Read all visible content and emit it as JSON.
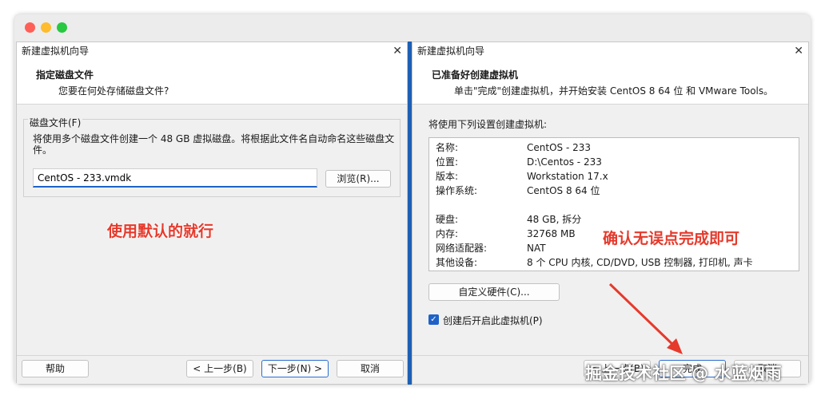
{
  "left_dialog": {
    "title": "新建虚拟机向导",
    "close": "✕",
    "heading": "指定磁盘文件",
    "subheading": "您要在何处存储磁盘文件?",
    "group_label": "磁盘文件(F)",
    "description": "将使用多个磁盘文件创建一个 48 GB 虚拟磁盘。将根据此文件名自动命名这些磁盘文件。",
    "file_value": "CentOS - 233.vmdk",
    "browse_label": "浏览(R)...",
    "help_label": "帮助",
    "prev_label": "< 上一步(B)",
    "next_label": "下一步(N) >",
    "cancel_label": "取消"
  },
  "right_dialog": {
    "title": "新建虚拟机向导",
    "close": "✕",
    "heading": "已准备好创建虚拟机",
    "subheading": "单击\"完成\"创建虚拟机，并开始安装 CentOS 8 64 位 和 VMware Tools。",
    "section_text": "将使用下列设置创建虚拟机:",
    "summary": [
      {
        "key": "名称:",
        "value": "CentOS - 233"
      },
      {
        "key": "位置:",
        "value": "D:\\Centos - 233"
      },
      {
        "key": "版本:",
        "value": "Workstation 17.x"
      },
      {
        "key": "操作系统:",
        "value": "CentOS 8 64 位"
      },
      {
        "key": "硬盘:",
        "value": "48 GB, 拆分"
      },
      {
        "key": "内存:",
        "value": "32768 MB"
      },
      {
        "key": "网络适配器:",
        "value": "NAT"
      },
      {
        "key": "其他设备:",
        "value": "8 个 CPU 内核, CD/DVD, USB 控制器, 打印机, 声卡"
      }
    ],
    "customize_label": "自定义硬件(C)...",
    "power_on_label": "创建后开启此虚拟机(P)",
    "power_on_checked": true,
    "prev_label": "< 上一步(B)",
    "finish_label": "完成",
    "cancel_label": "取消"
  },
  "annotations": {
    "left_note": "使用默认的就行",
    "right_note": "确认无误点完成即可",
    "color": "#e53a2c"
  },
  "watermark": "掘金技术社区 @ 水蓝烟雨",
  "colors": {
    "accent": "#1e62c8",
    "separator": "#1e5fb4"
  }
}
